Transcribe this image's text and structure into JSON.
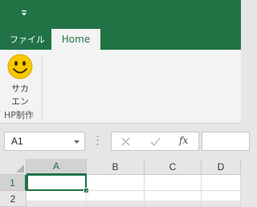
{
  "qat": {
    "customize_icon": "chevron-down-icon"
  },
  "tabs": [
    {
      "label": "ファイル"
    },
    {
      "label": "Home"
    }
  ],
  "ribbon": {
    "button": {
      "label_line1": "サカ",
      "label_line2": "エン",
      "icon": "smiley-face-icon"
    },
    "group_label": "HP制作"
  },
  "formula_bar": {
    "name_box": "A1",
    "fx_label": "fx",
    "formula_value": ""
  },
  "grid": {
    "columns": [
      "A",
      "B",
      "C",
      "D"
    ],
    "rows": [
      "1",
      "2"
    ],
    "active_cell": "A1"
  },
  "colors": {
    "accent": "#217346",
    "ribbon_bg": "#f3f3f3",
    "smiley": "#f7c800"
  }
}
